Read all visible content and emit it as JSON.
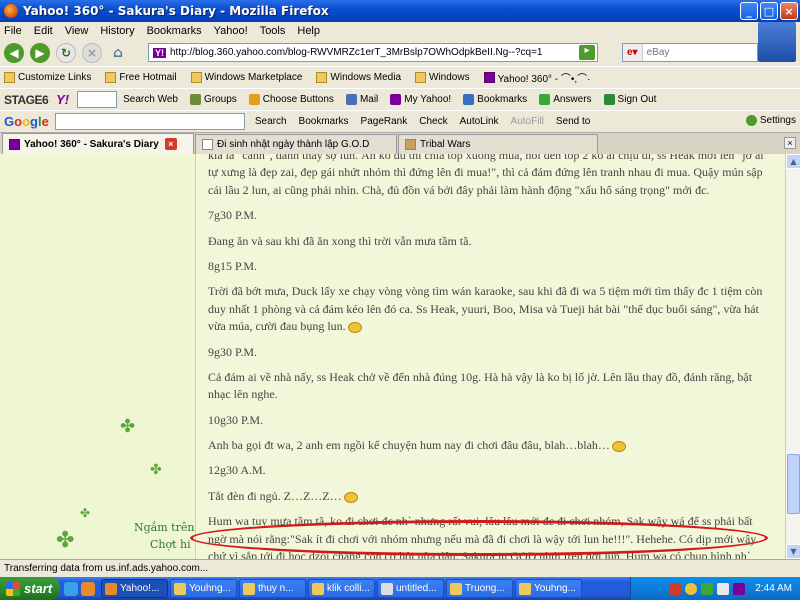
{
  "window": {
    "title": "Yahoo! 360° - Sakura's Diary - Mozilla Firefox",
    "minimize": "_",
    "maximize": "□",
    "close": "×"
  },
  "menu": [
    "File",
    "Edit",
    "View",
    "History",
    "Bookmarks",
    "Yahoo!",
    "Tools",
    "Help"
  ],
  "nav": {
    "url": "http://blog.360.yahoo.com/blog-RWVMRZc1erT_3MrBslp7OWhOdpkBeII.Ng--?cq=1",
    "url_badge": "Y!",
    "search_engine": "eBay",
    "search_placeholder": "eBay"
  },
  "bookmarks": [
    "Customize Links",
    "Free Hotmail",
    "Windows Marketplace",
    "Windows Media",
    "Windows",
    "Yahoo! 360° - ⌒•,⌒·"
  ],
  "yahoo_toolbar": {
    "stage": "STAGE6",
    "brand": "Y!",
    "items": [
      "Search Web",
      "Groups",
      "Choose Buttons",
      "Mail",
      "My Yahoo!",
      "Bookmarks",
      "Answers",
      "Sign Out"
    ]
  },
  "google_toolbar": {
    "logo": [
      "G",
      "o",
      "o",
      "g",
      "l",
      "e"
    ],
    "items": [
      "Search",
      "Bookmarks",
      "PageRank",
      "Check",
      "AutoLink",
      "AutoFill",
      "Send to"
    ],
    "settings": "Settings"
  },
  "tabs": [
    {
      "label": "Yahoo! 360° - Sakura's Diary",
      "active": true
    },
    {
      "label": "Đi sinh nhật ngày thành lập G.O.D",
      "active": false
    },
    {
      "label": "Tribal Wars",
      "active": false
    }
  ],
  "post": {
    "p0": "kia là \"cảnh\", đành thấy sợ lun. Ản ko đủ thì chia top xuống mùa, hỏi đến top 2 ko ai chịu đi, ss Heak mới lên \"jờ ai tự xưng là đẹp zai, đẹp gái nhứt nhóm thì đứng lên đi mua!\", thì cả đám đứng lên tranh nhau đi mua. Quậy mún sập cái lầu 2 lun, ai cũng phải nhìn. Chà, đủ đồn vá bởi đây phải làm hành động \"xấu hổ sáng trọng\" mới đc.",
    "t1": "7g30 P.M.",
    "p1": "Đang ăn và sau khi đã ăn xong thì trời vẫn mưa tầm tã.",
    "t2": "8g15 P.M.",
    "p2": "Trời đã bớt mưa, Duck lấy xe chạy vòng vòng tìm wán karaoke, sau khi đã đi wa 5 tiệm mới tìm thấy đc 1 tiệm còn duy nhất 1 phòng và cả đám kéo lên đó ca. Ss Heak, yuuri, Boo, Misa và Tueji hát bài \"thể dục buổi sáng\", vừa hát vừa múa, cười đau bụng lun.",
    "t3": "9g30 P.M.",
    "p3": "Cả đám ai về nhà nấy, ss Heak chở về đến nhà đúng 10g. Hà hà vậy là ko bị lố jờ. Lên lầu thay đồ, đánh răng, bật nhạc lên nghe.",
    "t4": "10g30 P.M.",
    "p4": "Anh ba gọi đt wa, 2 anh em ngồi kể chuyện hum nay đi chơi đâu đâu, blah…blah…",
    "t5": "12g30 A.M.",
    "p5": "Tắt đèn đi ngủ. Z…Z…Z…",
    "p6": "Hum wa tuy mưa tầm tã, ko đi chơi đc nh` nhưng rất vui, lâu lâu mới đc đi chơi nhóm, Sak wậy wá để ss phải bất ngờ mà nói rằng:\"Sak ít đi chơi với nhóm nhưng nếu mà đã đi chơi là wậy tới lun he!!!\". Hehehe. Có dịp mới wậy chứ vì sắp tới đi học dzồi chẳng còn cơ hội nữa đâu. Sakura iu GOD nhứt trên đời lun. Hum wa có chụp hình nh` lém, bữa nào post lên cho mọi ng` cùng thưởng thức nhé!"
  },
  "deco": {
    "line1": "Ngắm trên n",
    "line2": "Chợt hi"
  },
  "status": "Transferring data from us.inf.ads.yahoo.com...",
  "taskbar": {
    "start": "start",
    "items": [
      "Yahoo!...",
      "Youhng...",
      "thuy n...",
      "klik colli...",
      "untitled...",
      "Truong...",
      "Youhng..."
    ],
    "clock": "2:44 AM"
  }
}
